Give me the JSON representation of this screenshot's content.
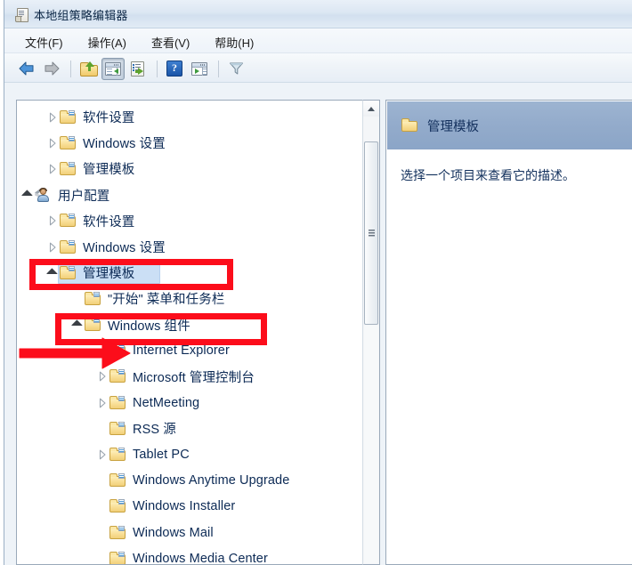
{
  "window": {
    "title": "本地组策略编辑器",
    "icon": "mmc-console-icon"
  },
  "menubar": {
    "items": [
      {
        "label": "文件(F)",
        "name": "menu-file"
      },
      {
        "label": "操作(A)",
        "name": "menu-action"
      },
      {
        "label": "查看(V)",
        "name": "menu-view"
      },
      {
        "label": "帮助(H)",
        "name": "menu-help"
      }
    ]
  },
  "toolbar": {
    "buttons": [
      {
        "icon": "back-arrow-icon",
        "label": "后退",
        "pressed": false
      },
      {
        "icon": "forward-arrow-icon",
        "label": "前进",
        "pressed": false
      },
      {
        "icon": "up-folder-icon",
        "label": "上一级",
        "pressed": false
      },
      {
        "icon": "show-hide-tree-icon",
        "label": "显示/隐藏控制台树",
        "pressed": true
      },
      {
        "icon": "export-list-icon",
        "label": "导出列表",
        "pressed": false
      },
      {
        "icon": "help-icon",
        "label": "帮助",
        "pressed": false
      },
      {
        "icon": "properties-window-icon",
        "label": "属性",
        "pressed": false
      },
      {
        "icon": "filter-funnel-icon",
        "label": "筛选器",
        "pressed": false
      }
    ],
    "help_glyph": "?"
  },
  "tree": {
    "rows": [
      {
        "label": "软件设置",
        "indent": 0,
        "state": "collapsed",
        "icon": "folder-icon",
        "selected": false
      },
      {
        "label": "Windows 设置",
        "indent": 0,
        "state": "collapsed",
        "icon": "folder-icon",
        "selected": false
      },
      {
        "label": "管理模板",
        "indent": 0,
        "state": "collapsed",
        "icon": "folder-icon",
        "selected": false
      },
      {
        "label": "用户配置",
        "indent": -1,
        "state": "expanded",
        "icon": "user-config-icon",
        "selected": false
      },
      {
        "label": "软件设置",
        "indent": 0,
        "state": "collapsed",
        "icon": "folder-icon",
        "selected": false
      },
      {
        "label": "Windows 设置",
        "indent": 0,
        "state": "collapsed",
        "icon": "folder-icon",
        "selected": false
      },
      {
        "label": "管理模板",
        "indent": 0,
        "state": "expanded",
        "icon": "folder-icon",
        "selected": true
      },
      {
        "label": "\"开始\" 菜单和任务栏",
        "indent": 1,
        "state": "leaf",
        "icon": "folder-icon",
        "selected": false
      },
      {
        "label": "Windows 组件",
        "indent": 1,
        "state": "expanded",
        "icon": "folder-icon",
        "selected": false
      },
      {
        "label": "Internet Explorer",
        "indent": 2,
        "state": "leaf",
        "icon": "folder-icon",
        "selected": false
      },
      {
        "label": "Microsoft 管理控制台",
        "indent": 2,
        "state": "collapsed",
        "icon": "folder-icon",
        "selected": false
      },
      {
        "label": "NetMeeting",
        "indent": 2,
        "state": "collapsed",
        "icon": "folder-icon",
        "selected": false
      },
      {
        "label": "RSS 源",
        "indent": 2,
        "state": "leaf",
        "icon": "folder-icon",
        "selected": false
      },
      {
        "label": "Tablet PC",
        "indent": 2,
        "state": "collapsed",
        "icon": "folder-icon",
        "selected": false
      },
      {
        "label": "Windows Anytime Upgrade",
        "indent": 2,
        "state": "leaf",
        "icon": "folder-icon",
        "selected": false
      },
      {
        "label": "Windows Installer",
        "indent": 2,
        "state": "leaf",
        "icon": "folder-icon",
        "selected": false
      },
      {
        "label": "Windows Mail",
        "indent": 2,
        "state": "leaf",
        "icon": "folder-icon",
        "selected": false
      },
      {
        "label": "Windows Media Center",
        "indent": 2,
        "state": "leaf",
        "icon": "folder-icon",
        "selected": false
      }
    ]
  },
  "scrollbar": {
    "up_arrow": "scroll-up-arrow-icon"
  },
  "detail": {
    "header_title": "管理模板",
    "header_icon": "folder-icon",
    "description": "选择一个项目来查看它的描述。"
  },
  "annotations": {
    "color": "#fc0d1b",
    "boxes": [
      {
        "name": "highlight-box-admin-templates",
        "target": "管理模板"
      },
      {
        "name": "highlight-box-windows-components",
        "target": "Windows 组件"
      }
    ],
    "arrows": [
      {
        "name": "pointer-arrow-internet-explorer",
        "target": "Internet Explorer"
      }
    ]
  }
}
